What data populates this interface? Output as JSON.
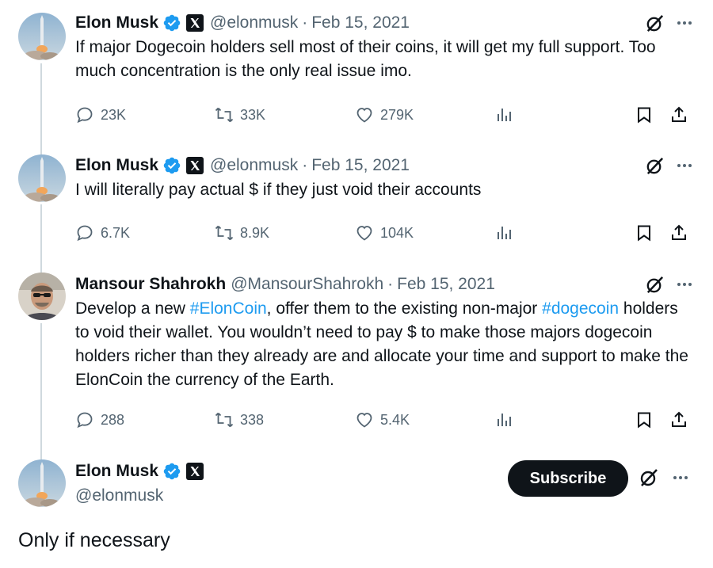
{
  "tweets": [
    {
      "name": "Elon Musk",
      "handle": "@elonmusk",
      "date": "Feb 15, 2021",
      "text": "If major Dogecoin holders sell most of their coins, it will get my full support. Too much concentration is the only real issue imo.",
      "replies": "23K",
      "reposts": "33K",
      "likes": "279K"
    },
    {
      "name": "Elon Musk",
      "handle": "@elonmusk",
      "date": "Feb 15, 2021",
      "text": "I will literally pay actual $ if they just void their accounts",
      "replies": "6.7K",
      "reposts": "8.9K",
      "likes": "104K"
    },
    {
      "name": "Mansour Shahrokh",
      "handle": "@MansourShahrokh",
      "date": "Feb 15, 2021",
      "text_parts": [
        "Develop a new ",
        "#ElonCoin",
        ", offer them to the existing non-major ",
        "#dogecoin",
        " holders to void their wallet. You wouldn’t need to pay $ to make those majors dogecoin holders richer than they already are and allocate your time and support to make the ElonCoin the currency of the Earth."
      ],
      "replies": "288",
      "reposts": "338",
      "likes": "5.4K"
    }
  ],
  "main": {
    "name": "Elon Musk",
    "handle": "@elonmusk",
    "subscribe_label": "Subscribe",
    "text": "Only if necessary"
  },
  "icons": {
    "verified": "verified-badge-icon",
    "affiliate": "x-logo-icon",
    "grok": "grok-icon",
    "more": "more-icon",
    "reply": "reply-icon",
    "repost": "repost-icon",
    "like": "like-icon",
    "views": "views-icon",
    "bookmark": "bookmark-icon",
    "share": "share-icon"
  },
  "colors": {
    "text": "#0f1419",
    "secondary": "#536471",
    "link": "#1d9bf0",
    "thread_line": "#cfd9de",
    "subscribe_bg": "#0f1419"
  }
}
